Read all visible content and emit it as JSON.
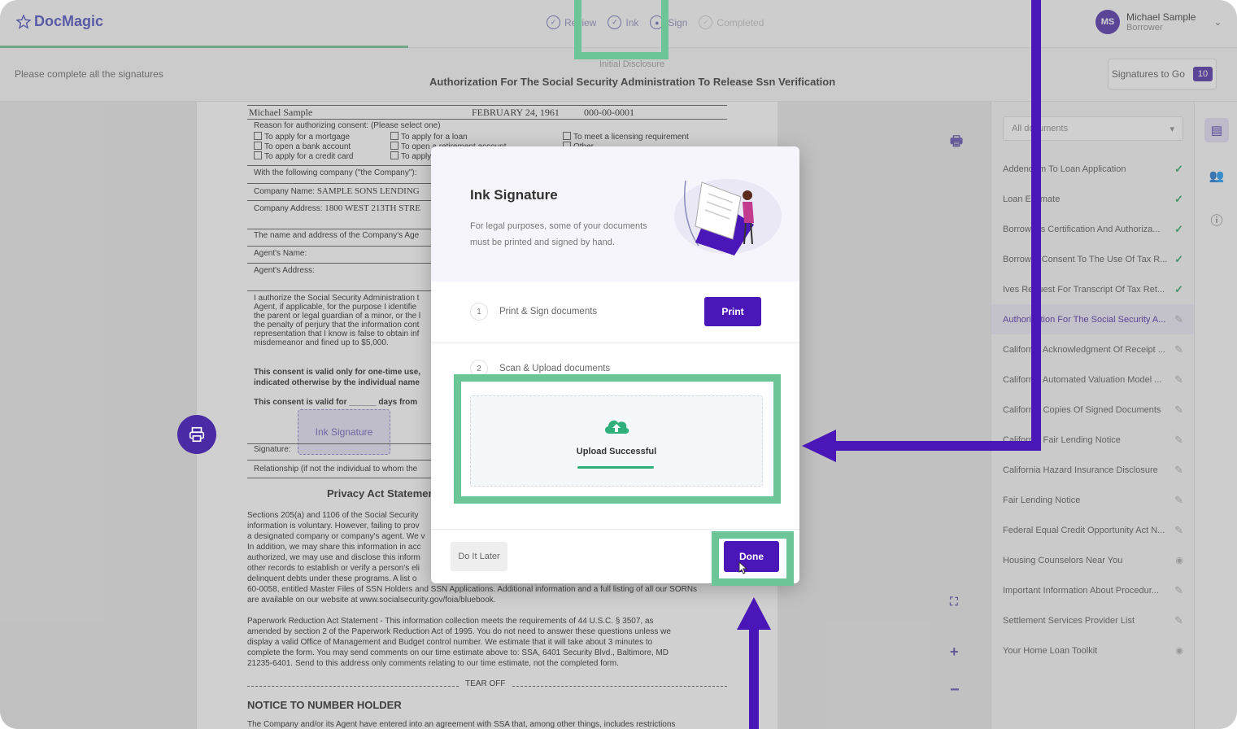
{
  "brand": {
    "name": "DocMagic",
    "color": "#4a4ac0"
  },
  "steps": [
    {
      "label": "Review",
      "icon": "check-circle-icon"
    },
    {
      "label": "Ink",
      "icon": "check-circle-icon"
    },
    {
      "label": "Sign",
      "icon": "progress-circle-icon"
    },
    {
      "label": "Completed",
      "icon": "check-circle-icon"
    }
  ],
  "user": {
    "initials": "MS",
    "name": "Michael Sample",
    "role": "Borrower"
  },
  "subbar": {
    "message": "Please complete all the signatures",
    "doc_group": "Initial Disclosure",
    "doc_title": "Authorization For The Social Security Administration To Release Ssn Verification",
    "signatures_label": "Signatures to Go",
    "signatures_count": "10"
  },
  "paper": {
    "name": "Michael Sample",
    "dob": "FEBRUARY 24, 1961",
    "ssn": "000-00-0001",
    "reason_label": "Reason for authorizing consent: (Please select one)",
    "reasons": [
      "To apply for a mortgage",
      "To open a bank account",
      "To apply for a credit card",
      "To apply for a loan",
      "To open a retirement account",
      "To apply for",
      "To meet a licensing requirement",
      "Other"
    ],
    "company_intro": "With the following company (\"the Company\"):",
    "company_name_label": "Company Name:",
    "company_name": "SAMPLE SONS LENDING",
    "company_address_label": "Company Address:",
    "company_address": "1800 WEST 213TH STRE",
    "agent_intro": "The name and address of the Company's Age",
    "agent_name": "Agent's Name:",
    "agent_address": "Agent's Address:",
    "authorize_p": [
      "I authorize the Social Security Administration t",
      "Agent, if applicable, for the purpose I identifie",
      "the parent or legal guardian of a minor, or the l",
      "the penalty of perjury that the information cont",
      "representation that I know is false to obtain inf",
      "misdemeanor and fined up to $5,000."
    ],
    "consent_1": [
      "This consent is valid only for one-time use,",
      "indicated otherwise by the individual name"
    ],
    "consent_2": "This consent is valid for ______ days from",
    "ink_signature": "Ink Signature",
    "signature_label": "Signature:",
    "relationship": "Relationship (if not the individual to whom the",
    "privacy_title": "Privacy Act Statemen",
    "privacy_p": [
      "Sections 205(a) and 1106 of the Social Security",
      "information is voluntary. However, failing to prov",
      "a designated company or company's agent. We v",
      "In addition, we may share this information in acc",
      "authorized, we may use and disclose this inform",
      "other records to establish or verify a person's eli",
      "delinquent debts under these programs. A list o",
      "60-0058, entitled Master Files of SSN Holders and SSN Applications. Additional information and a full listing of all our SORNs",
      "are available on our website at www.socialsecurity.gov/foia/bluebook."
    ],
    "paperwork_p": [
      "Paperwork Reduction Act Statement - This information collection meets the requirements of 44 U.S.C. § 3507, as",
      "amended by section 2 of the Paperwork Reduction Act of 1995. You do not need to answer these questions unless we",
      "display a valid Office of Management and Budget control number. We estimate that it will take about 3 minutes to",
      "complete the form. You may send comments on our time estimate above to: SSA, 6401 Security Blvd., Baltimore, MD",
      "21235-6401. Send to this address only comments relating to our time estimate, not the completed form."
    ],
    "tear_off": "TEAR OFF",
    "notice_title": "NOTICE TO NUMBER HOLDER",
    "notice_p": "The Company and/or its Agent have entered into an agreement with SSA that, among other things, includes restrictions"
  },
  "sidebar": {
    "filter": "All documents",
    "documents": [
      {
        "label": "Addendum To Loan Application",
        "status": "check"
      },
      {
        "label": "Loan Estimate",
        "status": "check"
      },
      {
        "label": "Borrower's Certification And Authoriza...",
        "status": "check"
      },
      {
        "label": "Borrower Consent To The Use Of Tax R...",
        "status": "check"
      },
      {
        "label": "Ives Request For Transcript Of Tax Ret...",
        "status": "check"
      },
      {
        "label": "Authorization For The Social Security A...",
        "status": "pen"
      },
      {
        "label": "California Acknowledgment Of Receipt ...",
        "status": "pen"
      },
      {
        "label": "California Automated Valuation Model ...",
        "status": "pen"
      },
      {
        "label": "California Copies Of Signed Documents",
        "status": "pen"
      },
      {
        "label": "California Fair Lending Notice",
        "status": "pen"
      },
      {
        "label": "California Hazard Insurance Disclosure",
        "status": "pen"
      },
      {
        "label": "Fair Lending Notice",
        "status": "pen"
      },
      {
        "label": "Federal Equal Credit Opportunity Act N...",
        "status": "pen"
      },
      {
        "label": "Housing Counselors Near You",
        "status": "eye"
      },
      {
        "label": "Important Information About Procedur...",
        "status": "pen"
      },
      {
        "label": "Settlement Services Provider List",
        "status": "pen"
      },
      {
        "label": "Your Home Loan Toolkit",
        "status": "eye"
      }
    ]
  },
  "modal": {
    "title": "Ink Signature",
    "description": "For legal purposes, some of your documents must be printed and signed by hand.",
    "step1": {
      "number": "1",
      "label": "Print & Sign documents",
      "button": "Print"
    },
    "step2": {
      "number": "2",
      "label": "Scan & Upload documents"
    },
    "upload_status": "Upload Successful",
    "upload_progress": 1.0,
    "later_button": "Do It Later",
    "done_button": "Done"
  },
  "colors": {
    "accent": "#4b16b8",
    "highlight": "#6cc597",
    "success": "#2fa46a"
  }
}
